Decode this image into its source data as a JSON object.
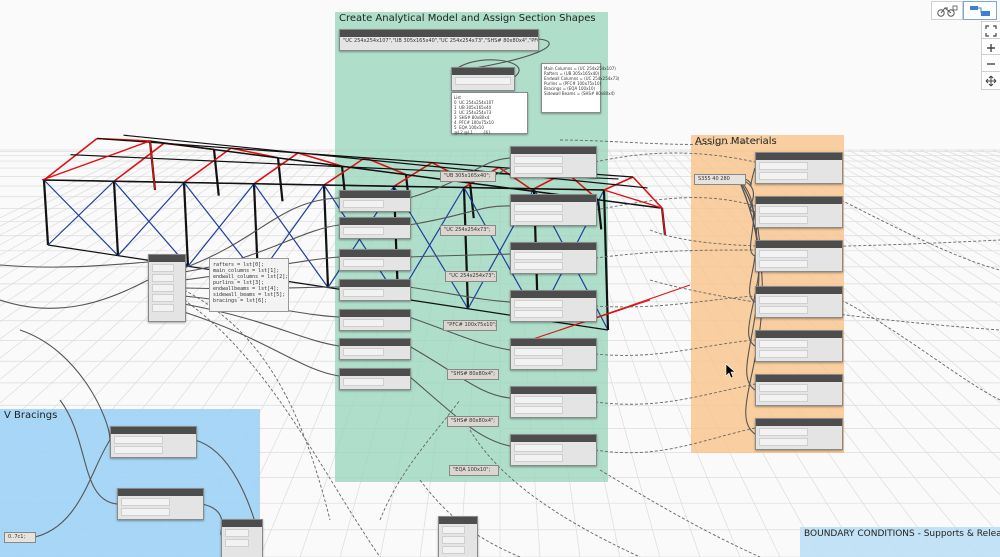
{
  "groups": {
    "section_shapes": {
      "title": "Create Analytical Model and Assign Section Shapes",
      "color": "#a8dfc9"
    },
    "materials": {
      "title": "Assign Materials",
      "color": "#f9c890"
    },
    "bracings": {
      "title": "V Bracings",
      "color": "#a9d6f5"
    },
    "boundary": {
      "title": "BOUNDARY CONDITIONS - Supports & Releases",
      "color": "#bfe0f4"
    }
  },
  "sections_string": "\"UC 254x254x107\",\"UB 305x165x40\",\"UC 254x254x73\",\"SHS# 80x80x4\",\"PFC# 100x75\"",
  "watch_lines": "Main Columns = (UC 254x254x107)\nRafters = (UB 305x165x40)\nEndwall Columns = (UC 254x254x73)\nPurlins = (PFC# 100x75x10)\nBracings = (EQA 100x10)\nSidewall Beams = (SHS# 80x80x4)",
  "list_lines": "List\n0  UC 254x254x107\n1  UB 305x165x40\n2  UC 254x254x73\n3  SHS# 80x80x4\n4  PFC# 100x75x10\n5  EQA 100x10\n@L2 @L1        {6}",
  "section_labels": {
    "ub": "\"UB 305x165x40\";",
    "uc254_73": "\"UC 254x254x73\";",
    "uc254_73b": "\"UC 254x254x73\";",
    "pfc": "\"PFC# 100x75x10\";",
    "shs1": "\"SHS# 80x80x4\";",
    "shs2": "\"SHS# 80x80x4\";",
    "eqa": "\"EQA 100x10\";"
  },
  "code_block": "rafters = lst[0];\nmain_columns = lst[1];\nendwall_columns = lst[2];\npurlins = lst[3];\nendwallbeams = lst[4];\nsidewall_beams = lst[5];\nbracings = lst[6];",
  "material_label": "S355 40 280",
  "bracing_value": "0..7c1;",
  "controls": [
    "view-3d",
    "view-graph"
  ],
  "zoom": [
    "fit",
    "zoom-in",
    "zoom-out",
    "pan"
  ]
}
